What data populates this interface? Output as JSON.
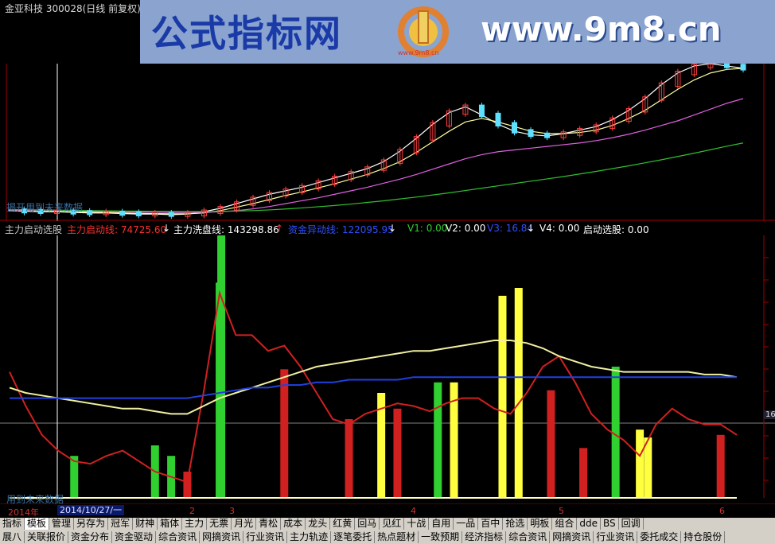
{
  "window": {
    "title": "金亚科技 300028(日线 前复权)"
  },
  "banner": {
    "title": "公式指标网",
    "url": "www.9m8.cn",
    "logo_text": "www.9m8.cn"
  },
  "price_panel": {
    "watermark": "揭开用到未来数据"
  },
  "indicator_header": {
    "items": [
      {
        "text": "主力启动选股",
        "color": "#c8c8c8"
      },
      {
        "text": "主力启动线: 74725.60",
        "color": "#ff3030"
      },
      {
        "text": "↓",
        "color": "#ffffff"
      },
      {
        "text": "主力洗盘线: 143298.86",
        "color": "#ffffff"
      },
      {
        "text": "↑",
        "color": "#ff3030"
      },
      {
        "text": "资金异动线: 122095.95",
        "color": "#3050ff"
      },
      {
        "text": "↓",
        "color": "#ffffff"
      },
      {
        "text": "V1: 0.00",
        "color": "#30d030"
      },
      {
        "text": "V2: 0.00",
        "color": "#ffffff"
      },
      {
        "text": "V3: 16.84",
        "color": "#3050ff"
      },
      {
        "text": "↓",
        "color": "#ffffff"
      },
      {
        "text": "V4: 0.00",
        "color": "#ffffff"
      },
      {
        "text": "启动选股: 0.00",
        "color": "#ffffff"
      }
    ]
  },
  "indicator_panel": {
    "watermark": "用到未来数据",
    "right_value": "16"
  },
  "axis": {
    "year": "2014年",
    "cursor_date": "2014/10/27/一",
    "months": [
      "2",
      "3",
      "4",
      "5",
      "6"
    ]
  },
  "tabs_row1": [
    "指标",
    "模板",
    "管理",
    "另存为",
    "冠军",
    "财神",
    "箱体",
    "主力",
    "无票",
    "月光",
    "青松",
    "成本",
    "龙头",
    "红黄",
    "回马",
    "见红",
    "十战",
    "自用",
    "一品",
    "百中",
    "抢选",
    "明板",
    "组合",
    "dde",
    "BS",
    "回调"
  ],
  "tabs_row1_active": 1,
  "tabs_row2": [
    "展八",
    "关联报价",
    "资金分布",
    "资金驱动",
    "综合资讯",
    "网摘资讯",
    "行业资讯",
    "主力轨迹",
    "逐笔委托",
    "热点题材",
    "一致预期",
    "经济指标",
    "综合资讯",
    "网摘资讯",
    "行业资讯",
    "委托成交",
    "持仓股份"
  ],
  "chart_data": [
    {
      "type": "line",
      "name": "price",
      "x": [
        0,
        2,
        4,
        6,
        8,
        10,
        12,
        14,
        16,
        18,
        20,
        22,
        24,
        26,
        28,
        30,
        32,
        34,
        36,
        38,
        40,
        42,
        44,
        46,
        48,
        50,
        52,
        54,
        56,
        58,
        60,
        62,
        64,
        66,
        68,
        70,
        72,
        74,
        76,
        78,
        80,
        82,
        84,
        86,
        88,
        90
      ],
      "series": [
        {
          "color": "#ffffff",
          "values": [
            4.4,
            4.35,
            4.3,
            4.3,
            4.25,
            4.2,
            4.2,
            4.15,
            4.1,
            4.1,
            4.05,
            4.1,
            4.3,
            4.6,
            5.0,
            5.4,
            5.8,
            6.1,
            6.4,
            6.8,
            7.2,
            7.6,
            8.0,
            8.6,
            9.5,
            10.6,
            11.8,
            12.8,
            13.3,
            12.6,
            11.8,
            11.2,
            10.9,
            10.8,
            11.0,
            11.3,
            11.6,
            12.2,
            13.0,
            14.0,
            15.2,
            16.2,
            16.8,
            17.0,
            16.8,
            16.6
          ]
        },
        {
          "color": "#ffffa0",
          "values": [
            4.4,
            4.38,
            4.35,
            4.32,
            4.3,
            4.27,
            4.24,
            4.2,
            4.17,
            4.14,
            4.12,
            4.12,
            4.2,
            4.4,
            4.7,
            5.0,
            5.35,
            5.7,
            6.0,
            6.35,
            6.7,
            7.1,
            7.5,
            8.0,
            8.6,
            9.4,
            10.3,
            11.2,
            12.0,
            12.3,
            12.0,
            11.6,
            11.2,
            11.0,
            11.0,
            11.1,
            11.3,
            11.7,
            12.3,
            13.0,
            13.9,
            14.8,
            15.6,
            16.2,
            16.5,
            16.6
          ]
        },
        {
          "color": "#e060e0",
          "values": [
            4.45,
            4.43,
            4.41,
            4.39,
            4.37,
            4.35,
            4.33,
            4.3,
            4.28,
            4.26,
            4.24,
            4.23,
            4.25,
            4.3,
            4.4,
            4.55,
            4.75,
            5.0,
            5.25,
            5.5,
            5.8,
            6.1,
            6.4,
            6.75,
            7.1,
            7.5,
            7.95,
            8.4,
            8.85,
            9.2,
            9.45,
            9.6,
            9.75,
            9.9,
            10.05,
            10.2,
            10.4,
            10.65,
            10.95,
            11.3,
            11.7,
            12.1,
            12.6,
            13.1,
            13.6,
            14.0
          ]
        },
        {
          "color": "#30c030",
          "values": [
            4.5,
            4.48,
            4.46,
            4.44,
            4.42,
            4.4,
            4.38,
            4.36,
            4.35,
            4.34,
            4.33,
            4.32,
            4.32,
            4.33,
            4.36,
            4.4,
            4.46,
            4.54,
            4.63,
            4.73,
            4.84,
            4.96,
            5.1,
            5.24,
            5.4,
            5.56,
            5.74,
            5.92,
            6.12,
            6.32,
            6.52,
            6.72,
            6.92,
            7.12,
            7.32,
            7.54,
            7.76,
            8.0,
            8.24,
            8.5,
            8.76,
            9.04,
            9.32,
            9.62,
            9.92,
            10.2
          ]
        }
      ],
      "ylim": [
        3.5,
        17.0
      ]
    },
    {
      "type": "bar",
      "name": "indicator",
      "x": [
        0,
        2,
        4,
        6,
        8,
        10,
        12,
        14,
        16,
        18,
        20,
        22,
        24,
        26,
        28,
        30,
        32,
        34,
        36,
        38,
        40,
        42,
        44,
        46,
        48,
        50,
        52,
        54,
        56,
        58,
        60,
        62,
        64,
        66,
        68,
        70,
        72,
        74,
        76,
        78,
        80,
        82,
        84,
        86,
        88,
        90
      ],
      "lines": [
        {
          "color": "#d02020",
          "values": [
            48,
            35,
            24,
            18,
            14,
            13,
            16,
            18,
            14,
            10,
            8,
            6,
            40,
            78,
            62,
            62,
            56,
            58,
            50,
            40,
            30,
            28,
            32,
            34,
            36,
            35,
            33,
            36,
            38,
            38,
            34,
            32,
            40,
            50,
            54,
            44,
            32,
            26,
            22,
            16,
            28,
            34,
            30,
            28,
            28,
            24
          ]
        },
        {
          "color": "#f0f0a0",
          "values": [
            42,
            40,
            39,
            38,
            37,
            36,
            35,
            34,
            34,
            33,
            32,
            32,
            35,
            38,
            40,
            42,
            44,
            46,
            48,
            50,
            51,
            52,
            53,
            54,
            55,
            56,
            56,
            57,
            58,
            59,
            60,
            60,
            59,
            57,
            54,
            52,
            50,
            49,
            48,
            48,
            48,
            48,
            48,
            47,
            47,
            46
          ]
        },
        {
          "color": "#2040e0",
          "values": [
            38,
            38,
            38,
            38,
            38,
            38,
            38,
            38,
            38,
            38,
            38,
            38,
            39,
            40,
            41,
            42,
            42,
            43,
            43,
            44,
            44,
            45,
            45,
            45,
            45,
            46,
            46,
            46,
            46,
            46,
            46,
            46,
            46,
            46,
            46,
            46,
            46,
            46,
            46,
            46,
            46,
            46,
            46,
            46,
            46,
            46
          ]
        }
      ],
      "bars": [
        {
          "x": 8,
          "value": 16,
          "color": "#30d030"
        },
        {
          "x": 18,
          "value": 20,
          "color": "#30d030"
        },
        {
          "x": 20,
          "value": 16,
          "color": "#30d030"
        },
        {
          "x": 22,
          "value": 10,
          "color": "#d02020"
        },
        {
          "x": 26,
          "value": 82,
          "color": "#30d030"
        },
        {
          "x": 26.2,
          "value": 100,
          "color": "#30d030"
        },
        {
          "x": 34,
          "value": 49,
          "color": "#d02020"
        },
        {
          "x": 42,
          "value": 30,
          "color": "#d02020"
        },
        {
          "x": 46,
          "value": 40,
          "color": "#ffff40"
        },
        {
          "x": 48,
          "value": 34,
          "color": "#d02020"
        },
        {
          "x": 53,
          "value": 44,
          "color": "#30d030"
        },
        {
          "x": 55,
          "value": 44,
          "color": "#ffff40"
        },
        {
          "x": 61,
          "value": 77,
          "color": "#ffff40"
        },
        {
          "x": 63,
          "value": 80,
          "color": "#ffff40"
        },
        {
          "x": 67,
          "value": 41,
          "color": "#d02020"
        },
        {
          "x": 71,
          "value": 19,
          "color": "#d02020"
        },
        {
          "x": 75,
          "value": 50,
          "color": "#30d030"
        },
        {
          "x": 78,
          "value": 26,
          "color": "#ffff40"
        },
        {
          "x": 79,
          "value": 23,
          "color": "#ffff40"
        },
        {
          "x": 88,
          "value": 24,
          "color": "#d02020"
        }
      ],
      "ylim": [
        0,
        100
      ]
    }
  ]
}
